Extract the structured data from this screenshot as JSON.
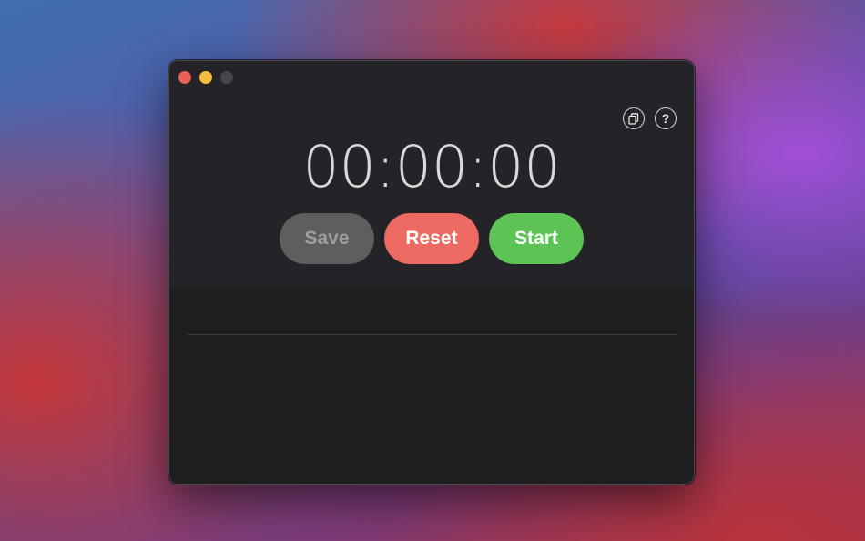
{
  "window": {
    "traffic_lights": [
      "close",
      "minimize",
      "zoom"
    ]
  },
  "toolbar": {
    "copy_icon": "copy-icon",
    "help_label": "?"
  },
  "timer": {
    "display": "00:00:00"
  },
  "controls": {
    "save_label": "Save",
    "reset_label": "Reset",
    "start_label": "Start"
  },
  "colors": {
    "close": "#ec5f58",
    "minimize": "#f5bd3b",
    "zoom_disabled": "#47474b",
    "save": "#5e5e61",
    "reset": "#ec6a61",
    "start": "#5cc354"
  },
  "laps": []
}
